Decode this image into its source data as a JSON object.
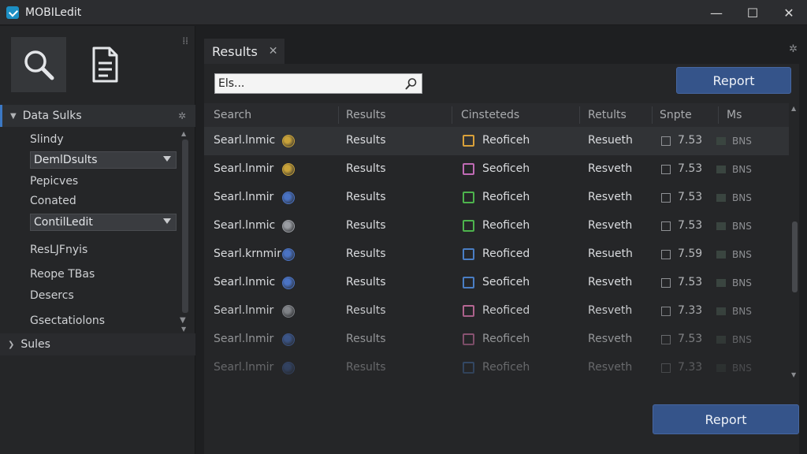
{
  "app": {
    "title": "MOBILedit",
    "icon_color": "#1d8fc4"
  },
  "window_controls": {
    "minimize": "—",
    "maximize": "☐",
    "close": "✕"
  },
  "toolbar": {
    "tools": [
      "search-icon",
      "document-icon"
    ]
  },
  "sidebar": {
    "data_section_label": "Data Sulks",
    "items": [
      {
        "label": "Slindy",
        "type": "text"
      },
      {
        "label": "DemlDsults",
        "type": "select"
      },
      {
        "label": "Pepicves",
        "type": "text"
      },
      {
        "label": "Conated",
        "type": "text"
      },
      {
        "label": "ContilLedit",
        "type": "select"
      },
      {
        "label": "ResLJFnyis",
        "type": "text"
      },
      {
        "label": "Reope TBas",
        "type": "text"
      },
      {
        "label": "Desercs",
        "type": "text"
      },
      {
        "label": "Gsectatiolons",
        "type": "text"
      }
    ],
    "second_section_label": "Sules"
  },
  "tabs": [
    {
      "label": "Results",
      "close": "✕"
    }
  ],
  "search": {
    "value": "Els..."
  },
  "buttons": {
    "report_top": "Report",
    "report_bottom": "Report"
  },
  "table": {
    "headers": [
      "Search",
      "Results",
      "Cinsteteds",
      "Retults",
      "Snpte",
      "Ms"
    ],
    "rows": [
      {
        "c1": "Searl.lnmic",
        "dot": "#c8a23a",
        "c2": "Results",
        "sq": "#d9a13a",
        "c3": "Reoficeh",
        "c4": "Resueth",
        "c5": "7.53",
        "c6": "BNS"
      },
      {
        "c1": "Searl.lnmir",
        "dot": "#c8a23a",
        "c2": "Results",
        "sq": "#c06bb5",
        "c3": "Seoficeh",
        "c4": "Resveth",
        "c5": "7.53",
        "c6": "BNS"
      },
      {
        "c1": "Searl.lnmir",
        "dot": "#4a73c4",
        "c2": "Results",
        "sq": "#4db34d",
        "c3": "Reoficeh",
        "c4": "Resveth",
        "c5": "7.53",
        "c6": "BNS"
      },
      {
        "c1": "Searl.lnmic",
        "dot": "#9a9da2",
        "c2": "Results",
        "sq": "#4db34d",
        "c3": "Reoficeh",
        "c4": "Resveth",
        "c5": "7.53",
        "c6": "BNS"
      },
      {
        "c1": "Searl.krnmir",
        "dot": "#4a73c4",
        "c2": "Results",
        "sq": "#4a7ec4",
        "c3": "Reoficed",
        "c4": "Resueth",
        "c5": "7.59",
        "c6": "BNS"
      },
      {
        "c1": "Searl.lnmic",
        "dot": "#4a73c4",
        "c2": "Results",
        "sq": "#4a7ec4",
        "c3": "Seoficeh",
        "c4": "Resveth",
        "c5": "7.53",
        "c6": "BNS"
      },
      {
        "c1": "Searl.lnmir",
        "dot": "#8a8d92",
        "c2": "Results",
        "sq": "#c06b9a",
        "c3": "Reoficed",
        "c4": "Resveth",
        "c5": "7.33",
        "c6": "BNS"
      },
      {
        "c1": "Searl.lnmir",
        "dot": "#4a73c4",
        "c2": "Results",
        "sq": "#c06b9a",
        "c3": "Reoficeh",
        "c4": "Resveth",
        "c5": "7.53",
        "c6": "BNS"
      },
      {
        "c1": "Searl.lnmir",
        "dot": "#4a73c4",
        "c2": "Results",
        "sq": "#4a7ec4",
        "c3": "Reoficeh",
        "c4": "Resveth",
        "c5": "7.33",
        "c6": "BNS"
      }
    ]
  }
}
